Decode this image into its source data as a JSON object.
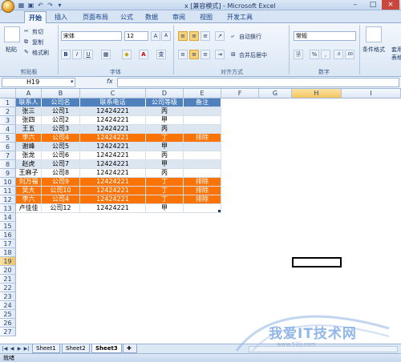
{
  "window": {
    "title": "x [兼容模式] - Microsoft Excel",
    "controls": [
      "–",
      "□",
      "×"
    ]
  },
  "ribbon": {
    "tabs": [
      "开始",
      "插入",
      "页面布局",
      "公式",
      "数据",
      "审阅",
      "视图",
      "开发工具"
    ],
    "active_tab": "开始",
    "clipboard": {
      "paste": "粘贴",
      "cut": "剪切",
      "copy": "复制",
      "format_painter": "格式刷",
      "label": "剪贴板"
    },
    "font": {
      "name": "宋体",
      "size": "12",
      "bold": "B",
      "italic": "I",
      "underline": "U",
      "grow": "A",
      "shrink": "A",
      "font_color": "A",
      "fill": "◆",
      "wen": "变",
      "label": "字体"
    },
    "alignment": {
      "wrap_text": "自动换行",
      "merge_center": "合并后居中",
      "label": "对齐方式"
    },
    "number": {
      "format": "常规",
      "currency": "🗟",
      "percent": "%",
      "comma": ",",
      "inc": ".0",
      "dec": ".00",
      "label": "数字"
    },
    "styles": {
      "conditional": "条件格式",
      "table": "套用",
      "table2": "表格"
    }
  },
  "formula_bar": {
    "name_box": "H19",
    "fx": "fx",
    "formula": ""
  },
  "sheet": {
    "columns": [
      "A",
      "B",
      "C",
      "D",
      "E",
      "F",
      "G",
      "H",
      "I"
    ],
    "selected_column": "H",
    "selected_row": "19",
    "row_numbers": [
      "1",
      "2",
      "3",
      "4",
      "5",
      "6",
      "7",
      "8",
      "9",
      "10",
      "11",
      "12",
      "13",
      "14",
      "15",
      "16",
      "17",
      "18",
      "19",
      "20",
      "21",
      "22",
      "23",
      "24",
      "25",
      "26",
      "27"
    ],
    "table_headers": [
      "联系人",
      "公司名",
      "联系电话",
      "公司等级",
      "备注"
    ],
    "rows": [
      {
        "a": "张三",
        "b": "公司1",
        "c": "12424221",
        "d": "丙",
        "e": "",
        "hl": false
      },
      {
        "a": "张四",
        "b": "公司2",
        "c": "12424221",
        "d": "甲",
        "e": "",
        "hl": false
      },
      {
        "a": "王五",
        "b": "公司3",
        "c": "12424221",
        "d": "丙",
        "e": "",
        "hl": false
      },
      {
        "a": "李六",
        "b": "公司4",
        "c": "12424221",
        "d": "丁",
        "e": "排除",
        "hl": true
      },
      {
        "a": "谢峰",
        "b": "公司5",
        "c": "12424221",
        "d": "甲",
        "e": "",
        "hl": false
      },
      {
        "a": "张龙",
        "b": "公司6",
        "c": "12424221",
        "d": "丙",
        "e": "",
        "hl": false
      },
      {
        "a": "赵虎",
        "b": "公司7",
        "c": "12424221",
        "d": "甲",
        "e": "",
        "hl": false
      },
      {
        "a": "王麻子",
        "b": "公司8",
        "c": "12424221",
        "d": "丙",
        "e": "",
        "hl": false
      },
      {
        "a": "刘万福",
        "b": "公司9",
        "c": "12424221",
        "d": "丁",
        "e": "排除",
        "hl": true
      },
      {
        "a": "吴大",
        "b": "公司10",
        "c": "12424221",
        "d": "丁",
        "e": "排除",
        "hl": true
      },
      {
        "a": "李六",
        "b": "公司4",
        "c": "12424221",
        "d": "丁",
        "e": "排除",
        "hl": true
      },
      {
        "a": "卢佳佳",
        "b": "公司12",
        "c": "12424221",
        "d": "甲",
        "e": "",
        "hl": false
      }
    ],
    "colors": {
      "header_fill": "#4f81bd",
      "band_fill": "#dce6f1",
      "highlight_fill": "#f97306",
      "highlight_text": "#ffffff"
    }
  },
  "sheet_tabs": {
    "tabs": [
      "Sheet1",
      "Sheet2",
      "Sheet3"
    ],
    "active": "Sheet3"
  },
  "status_bar": {
    "text": "就绪"
  },
  "watermark": {
    "title": "我爱IT技术网",
    "url": "www.52ij.com"
  }
}
